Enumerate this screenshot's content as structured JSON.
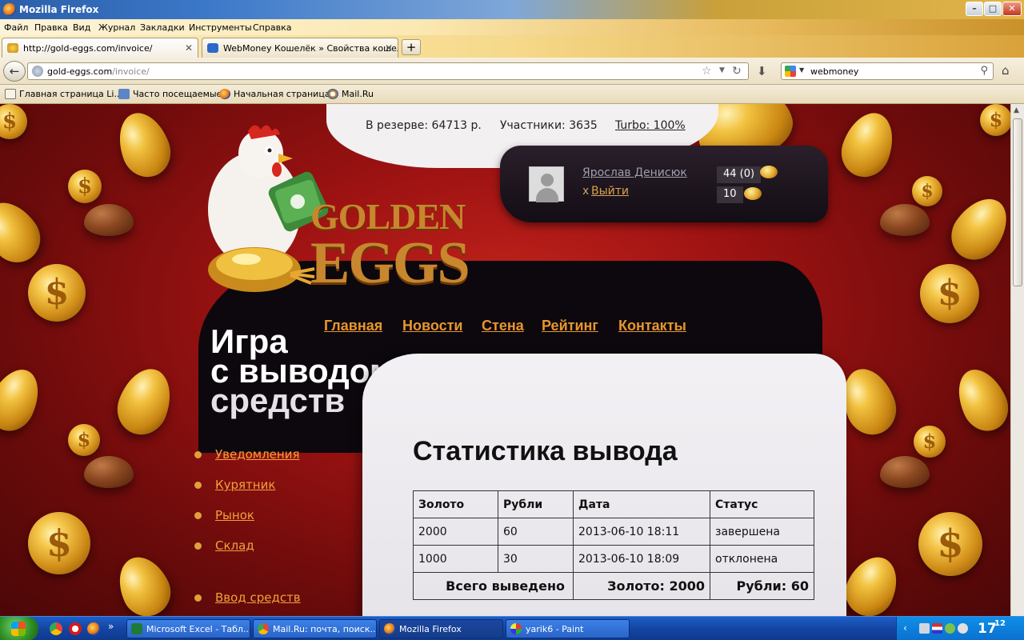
{
  "window": {
    "title": "Mozilla Firefox",
    "min": "–",
    "max": "□",
    "close": "✕"
  },
  "menu": [
    "Файл",
    "Правка",
    "Вид",
    "Журнал",
    "Закладки",
    "Инструменты",
    "Справка"
  ],
  "tabs": [
    {
      "label": "http://gold-eggs.com/invoice/",
      "close": "✕"
    },
    {
      "label": "WebMoney Кошелёк » Свойства кошел...",
      "close": "✕"
    }
  ],
  "newtab": "+",
  "address": {
    "domain": "gold-eggs.com",
    "path": "/invoice/"
  },
  "search": {
    "engine": "google",
    "value": "webmoney"
  },
  "bookmarks": [
    "Главная страница Li...",
    "Часто посещаемые",
    "Начальная страница",
    "Mail.Ru"
  ],
  "stats": {
    "reserve": "В резерве: 64713 р.",
    "members": "Участники: 3635",
    "turbo": "Turbo: 100%"
  },
  "user": {
    "name": "Ярослав Денисюк",
    "logout_prefix": "х",
    "logout": "Выйти",
    "gold": "44 (0)",
    "eggs": "10"
  },
  "logo": {
    "line1": "GOLDEN",
    "line2": "EGGS"
  },
  "nav": [
    "Главная",
    "Новости",
    "Стена",
    "Рейтинг",
    "Контакты"
  ],
  "slogan": [
    "Игра",
    "с выводом",
    "средств"
  ],
  "sidebar": [
    "Уведомления",
    "Курятник",
    "Рынок",
    "Склад",
    "Ввод средств"
  ],
  "page": {
    "title": "Статистика вывода",
    "table": {
      "headers": [
        "Золото",
        "Рубли",
        "Дата",
        "Статус"
      ],
      "rows": [
        [
          "2000",
          "60",
          "2013-06-10 18:11",
          "завершена"
        ],
        [
          "1000",
          "30",
          "2013-06-10 18:09",
          "отклонена"
        ]
      ],
      "total_label": "Всего выведено",
      "total_gold": "Золото: 2000",
      "total_rub": "Рубли: 60"
    }
  },
  "taskbar": {
    "tasks": [
      "Microsoft Excel - Табл...",
      "Mail.Ru: почта, поиск...",
      "Mozilla Firefox",
      "yarik6 - Paint"
    ],
    "clock_hour": "17",
    "clock_min": "12"
  },
  "colors": {
    "accent": "#e8962c",
    "background": "#9c1212",
    "panel": "#0d080e"
  }
}
